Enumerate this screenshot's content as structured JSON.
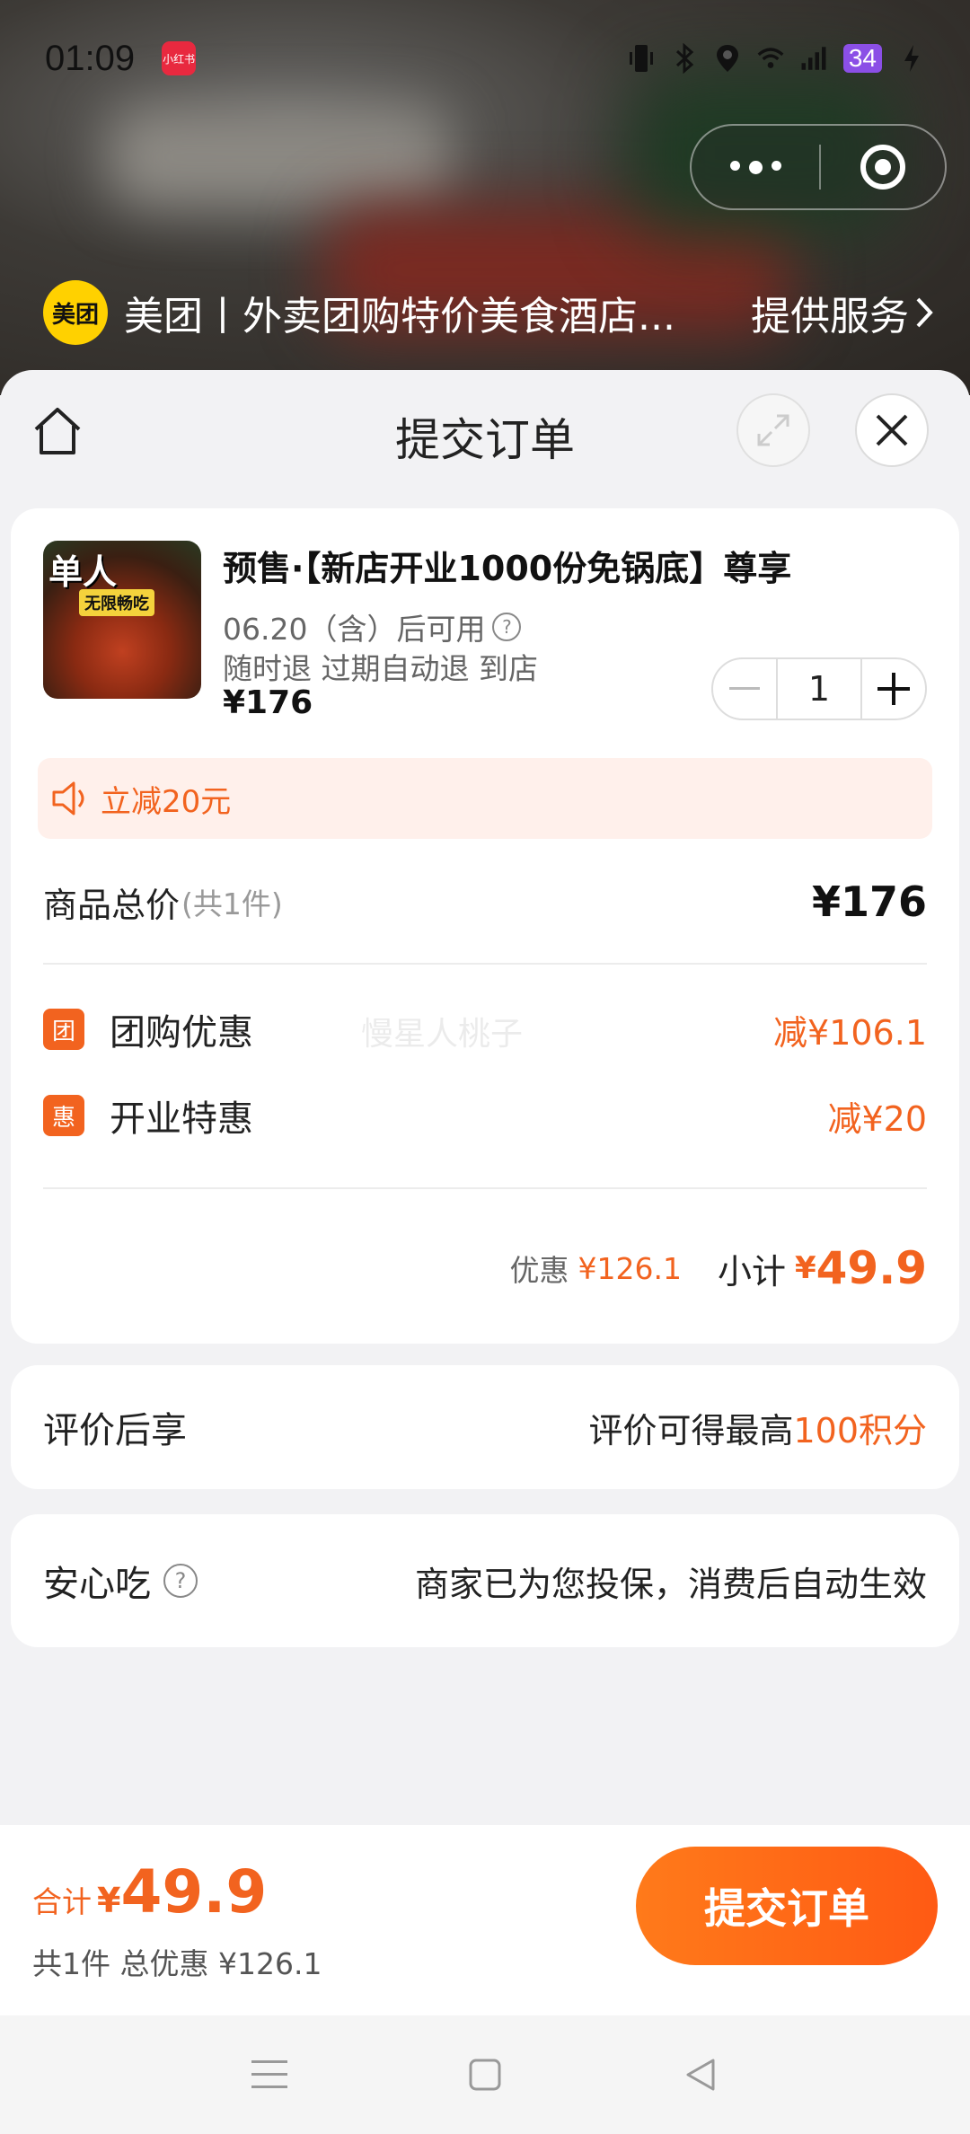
{
  "status_bar": {
    "time": "01:09",
    "app_badge": "小红书",
    "battery": "34"
  },
  "provider": {
    "logo_text": "美团",
    "name": "美团丨外卖团购特价美食酒店...",
    "service_label": "提供服务"
  },
  "sheet": {
    "title": "提交订单"
  },
  "product": {
    "thumb_text1": "单人",
    "thumb_text2": "无限畅吃",
    "title": "预售·【新店开业1000份免锅底】尊享",
    "date": "06.20（含）后可用",
    "tags": "随时退 过期自动退 到店",
    "price": "¥176",
    "quantity": "1"
  },
  "promo": {
    "text": "立减20元"
  },
  "summary": {
    "total_label": "商品总价",
    "total_count": "(共1件)",
    "total_amount": "¥176",
    "discounts": [
      {
        "tag": "团",
        "name": "团购优惠",
        "value": "减¥106.1"
      },
      {
        "tag": "惠",
        "name": "开业特惠",
        "value": "减¥20"
      }
    ],
    "watermark": "慢星人桃子",
    "saving_label": "优惠",
    "saving_value": "¥126.1",
    "subtotal_label": "小计",
    "subtotal_currency": "¥",
    "subtotal_value": "49.9"
  },
  "review": {
    "label": "评价后享",
    "text_prefix": "评价可得最高",
    "text_highlight": "100积分"
  },
  "safe": {
    "label": "安心吃",
    "text": "商家已为您投保，消费后自动生效"
  },
  "bottom_bar": {
    "total_label": "合计",
    "total_currency": "¥",
    "total_value": "49.9",
    "sub_text": "共1件 总优惠 ¥126.1",
    "submit_label": "提交订单"
  },
  "colors": {
    "accent": "#f2631f",
    "promo_bg": "#fff0eb",
    "brand_yellow": "#ffd100"
  }
}
